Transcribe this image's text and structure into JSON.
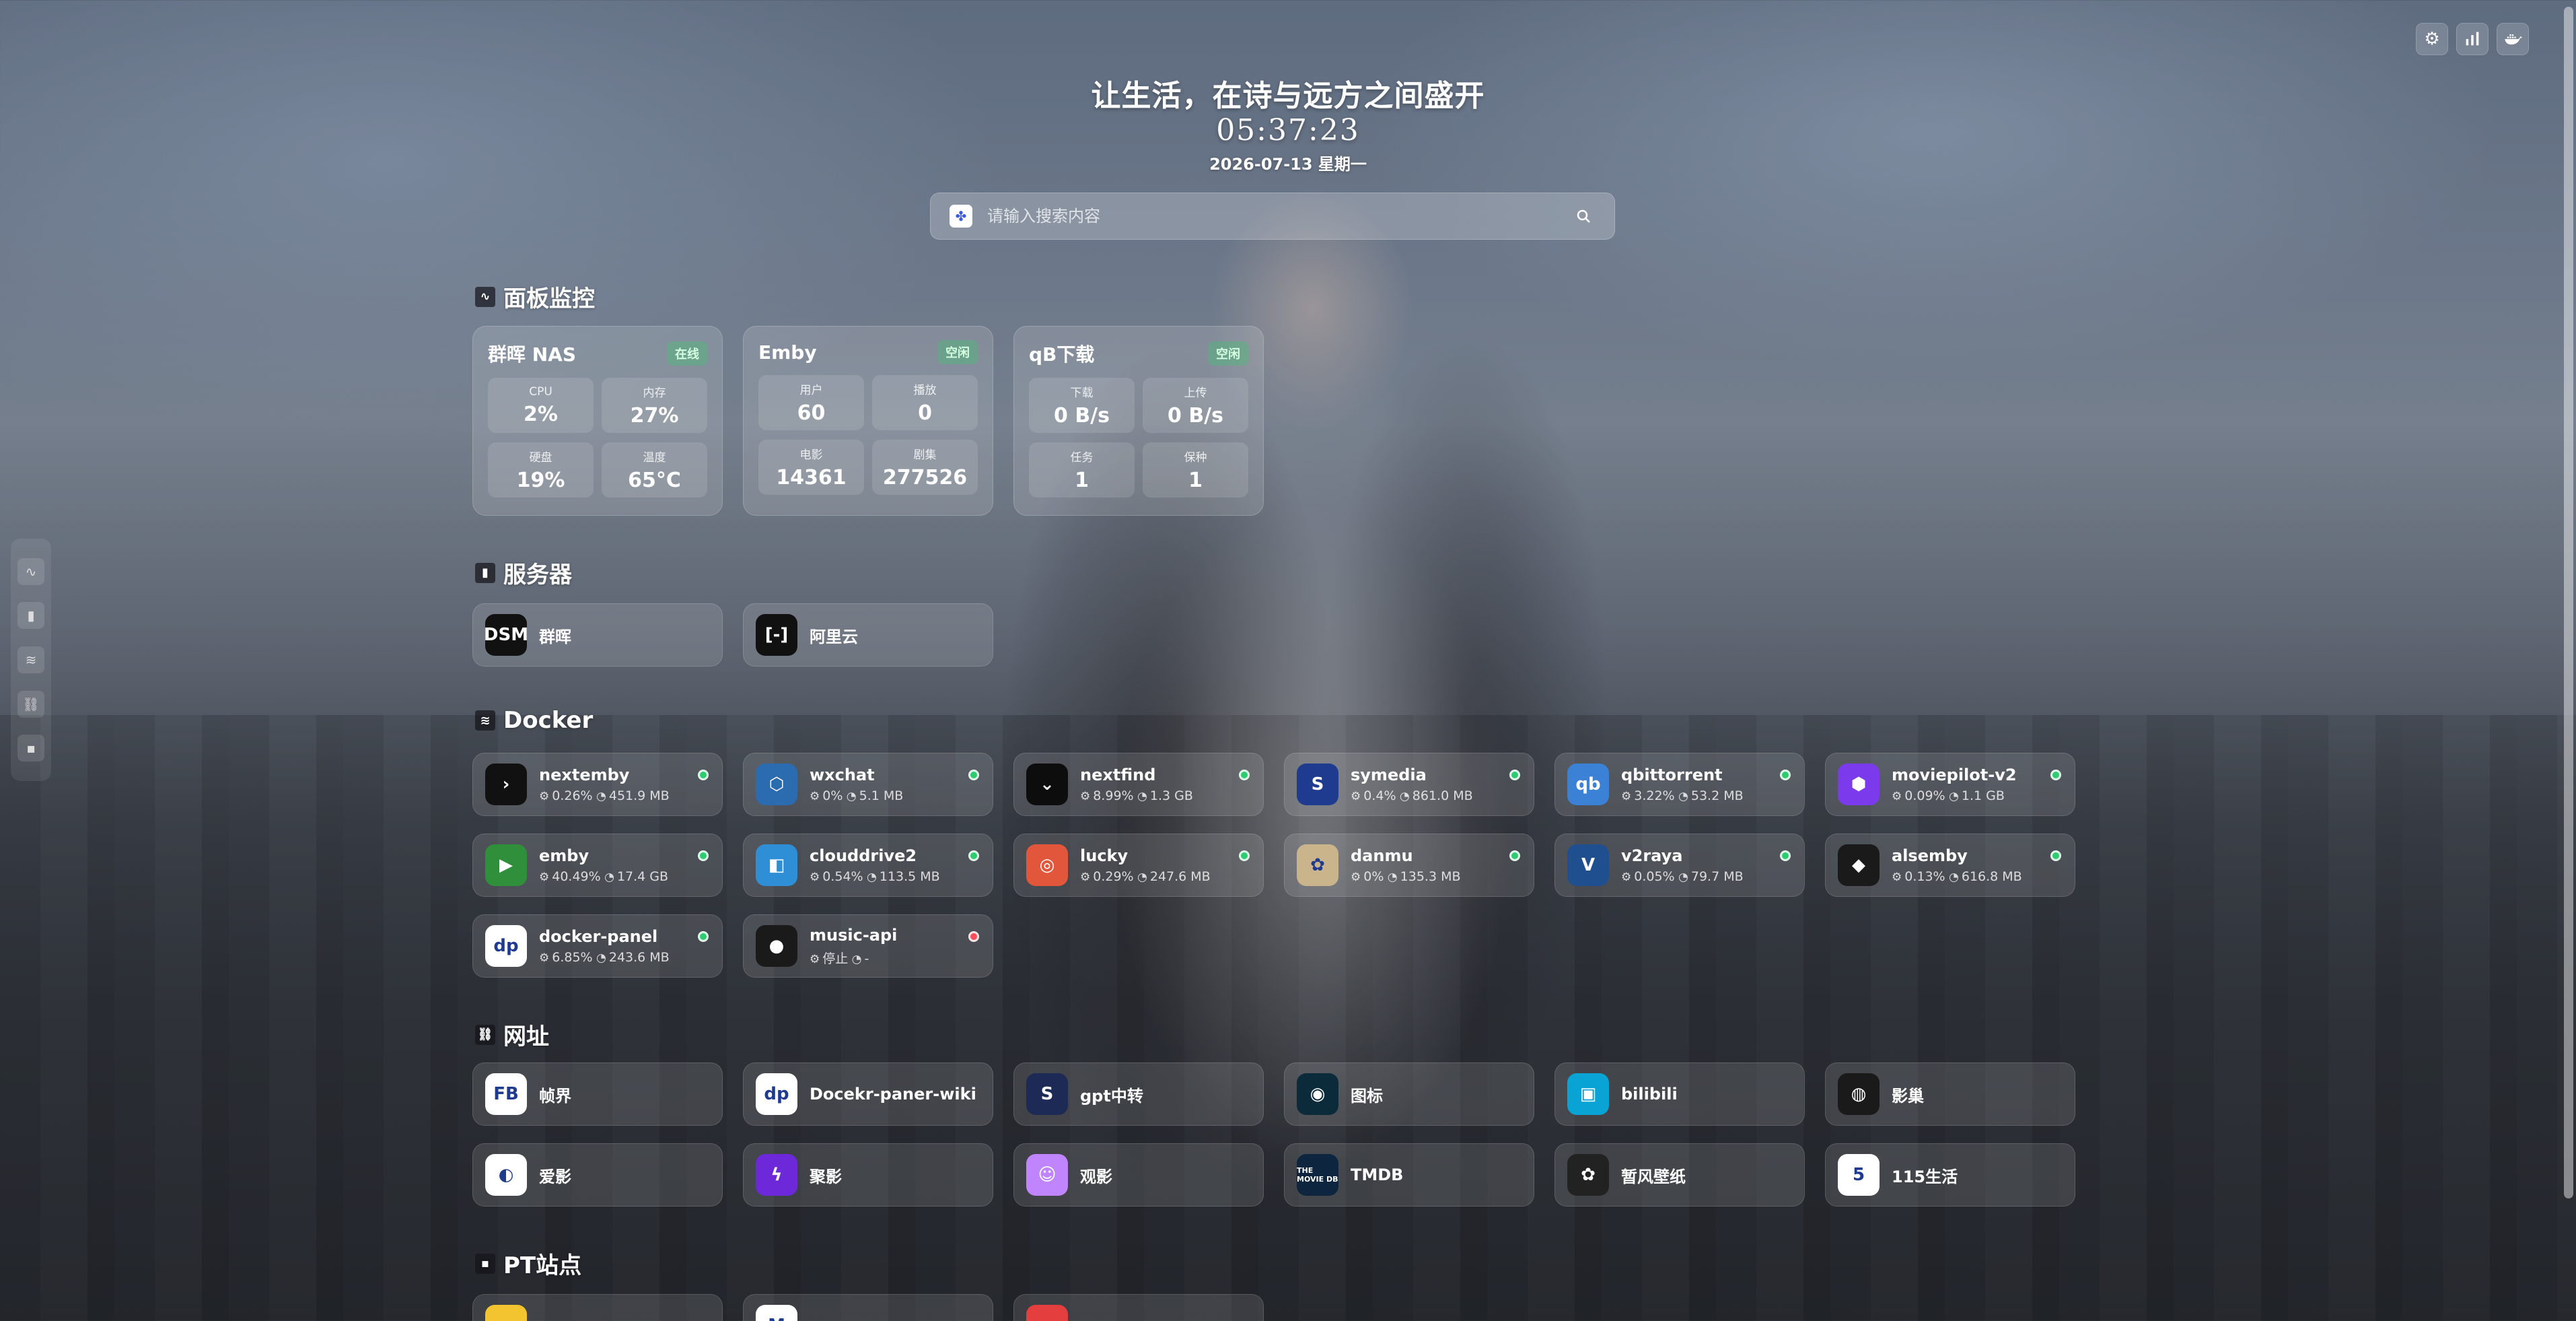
{
  "slogan": "让生活，在诗与远方之间盛开",
  "clock": "05:37:23",
  "date": "2026-07-13 星期一",
  "search": {
    "placeholder": "请输入搜索内容",
    "engine_icon": "baidu-paw-icon"
  },
  "top_tools": [
    {
      "name": "settings",
      "icon": "⚙"
    },
    {
      "name": "stats",
      "icon": "bar-chart-icon"
    },
    {
      "name": "docker",
      "icon": "docker-icon"
    }
  ],
  "sections": {
    "monitor": "面板监控",
    "servers": "服务器",
    "docker": "Docker",
    "urls": "网址",
    "pt": "PT站点"
  },
  "monitor": [
    {
      "title": "群晖 NAS",
      "badge": "在线",
      "cells": [
        {
          "label": "CPU",
          "value": "2%"
        },
        {
          "label": "内存",
          "value": "27%"
        },
        {
          "label": "硬盘",
          "value": "19%"
        },
        {
          "label": "温度",
          "value": "65°C"
        }
      ]
    },
    {
      "title": "Emby",
      "badge": "空闲",
      "cells": [
        {
          "label": "用户",
          "value": "60"
        },
        {
          "label": "播放",
          "value": "0"
        },
        {
          "label": "电影",
          "value": "14361"
        },
        {
          "label": "剧集",
          "value": "277526"
        }
      ]
    },
    {
      "title": "qB下载",
      "badge": "空闲",
      "cells": [
        {
          "label": "下载",
          "value": "0 B/s"
        },
        {
          "label": "上传",
          "value": "0 B/s"
        },
        {
          "label": "任务",
          "value": "1"
        },
        {
          "label": "保种",
          "value": "1"
        }
      ]
    }
  ],
  "servers": [
    {
      "name": "群晖",
      "icon_text": "DSM",
      "color": "#111111"
    },
    {
      "name": "阿里云",
      "icon_text": "[-]",
      "color": "#111111"
    }
  ],
  "docker": [
    {
      "name": "nextemby",
      "cpu": "0.26%",
      "mem": "451.9 MB",
      "status": "running",
      "icon_text": "›",
      "color": "#111111"
    },
    {
      "name": "wxchat",
      "cpu": "0%",
      "mem": "5.1 MB",
      "status": "running",
      "icon_text": "⬡",
      "color": "#2b6cb0"
    },
    {
      "name": "nextfind",
      "cpu": "8.99%",
      "mem": "1.3 GB",
      "status": "running",
      "icon_text": "⌄",
      "color": "#0d0d0d"
    },
    {
      "name": "symedia",
      "cpu": "0.4%",
      "mem": "861.0 MB",
      "status": "running",
      "icon_text": "S",
      "color": "#1f3b8f"
    },
    {
      "name": "qbittorrent",
      "cpu": "3.22%",
      "mem": "53.2 MB",
      "status": "running",
      "icon_text": "qb",
      "color": "#3b82d6"
    },
    {
      "name": "moviepilot-v2",
      "cpu": "0.09%",
      "mem": "1.1 GB",
      "status": "running",
      "icon_text": "⬢",
      "color": "#7c3aed"
    },
    {
      "name": "emby",
      "cpu": "40.49%",
      "mem": "17.4 GB",
      "status": "running",
      "icon_text": "▶",
      "color": "#2f8f3a"
    },
    {
      "name": "clouddrive2",
      "cpu": "0.54%",
      "mem": "113.5 MB",
      "status": "running",
      "icon_text": "◧",
      "color": "#2f8fd6"
    },
    {
      "name": "lucky",
      "cpu": "0.29%",
      "mem": "247.6 MB",
      "status": "running",
      "icon_text": "◎",
      "color": "#e2563b"
    },
    {
      "name": "danmu",
      "cpu": "0%",
      "mem": "135.3 MB",
      "status": "running",
      "icon_text": "✿",
      "color": "#c9b48c"
    },
    {
      "name": "v2raya",
      "cpu": "0.05%",
      "mem": "79.7 MB",
      "status": "running",
      "icon_text": "V",
      "color": "#1f4f8f"
    },
    {
      "name": "alsemby",
      "cpu": "0.13%",
      "mem": "616.8 MB",
      "status": "running",
      "icon_text": "◆",
      "color": "#1a1a1a"
    },
    {
      "name": "docker-panel",
      "cpu": "6.85%",
      "mem": "243.6 MB",
      "status": "running",
      "icon_text": "dp",
      "color": "#ffffff"
    },
    {
      "name": "music-api",
      "cpu": "停止",
      "mem": "-",
      "status": "stopped",
      "icon_text": "●",
      "color": "#1a1a1a"
    }
  ],
  "urls": [
    {
      "name": "帧界",
      "icon_text": "FB",
      "color": "#ffffff"
    },
    {
      "name": "Docekr-paner-wiki",
      "icon_text": "dp",
      "color": "#ffffff"
    },
    {
      "name": "gpt中转",
      "icon_text": "S",
      "color": "#1d2a55"
    },
    {
      "name": "图标",
      "icon_text": "◉",
      "color": "#0b2a3a"
    },
    {
      "name": "bilibili",
      "icon_text": "▣",
      "color": "#0aa3d6"
    },
    {
      "name": "影巢",
      "icon_text": "◍",
      "color": "#1a1a1a"
    },
    {
      "name": "爱影",
      "icon_text": "◐",
      "color": "#ffffff"
    },
    {
      "name": "聚影",
      "icon_text": "ϟ",
      "color": "#6d28d9"
    },
    {
      "name": "观影",
      "icon_text": "☺",
      "color": "#c084fc"
    },
    {
      "name": "TMDB",
      "icon_text": "THE MOVIE DB",
      "color": "#0d253f"
    },
    {
      "name": "暂风壁纸",
      "icon_text": "✿",
      "color": "#222222"
    },
    {
      "name": "115生活",
      "icon_text": "5",
      "color": "#ffffff"
    }
  ],
  "pt": [
    {
      "name": "",
      "icon_text": "",
      "color": "#f4c430"
    },
    {
      "name": "",
      "icon_text": "M",
      "color": "#ffffff"
    },
    {
      "name": "",
      "icon_text": "",
      "color": "#e53e3e"
    }
  ]
}
